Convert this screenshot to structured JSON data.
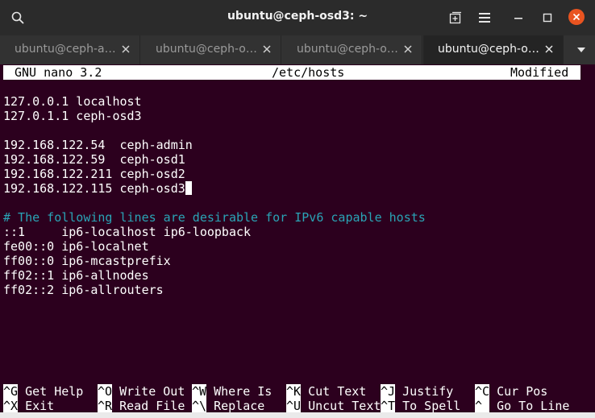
{
  "window": {
    "title": "ubuntu@ceph-osd3: ~",
    "close_color": "#e95420",
    "icons": [
      "search-icon",
      "new-tab-icon",
      "hamburger-menu-icon",
      "minimize-icon",
      "maximize-icon",
      "close-icon"
    ]
  },
  "tabs": [
    {
      "label": "ubuntu@ceph-a…",
      "active": false
    },
    {
      "label": "ubuntu@ceph-o…",
      "active": false
    },
    {
      "label": "ubuntu@ceph-o…",
      "active": false
    },
    {
      "label": "ubuntu@ceph-o…",
      "active": true
    }
  ],
  "nano": {
    "version": "GNU nano 3.2",
    "filename": "/etc/hosts",
    "status": "Modified"
  },
  "file_lines": [
    "",
    "127.0.0.1 localhost",
    "127.0.1.1 ceph-osd3",
    "",
    "192.168.122.54  ceph-admin",
    "192.168.122.59  ceph-osd1",
    "192.168.122.211 ceph-osd2",
    "192.168.122.115 ceph-osd3",
    "",
    "# The following lines are desirable for IPv6 capable hosts",
    "::1     ip6-localhost ip6-loopback",
    "fe00::0 ip6-localnet",
    "ff00::0 ip6-mcastprefix",
    "ff02::1 ip6-allnodes",
    "ff02::2 ip6-allrouters"
  ],
  "shortcuts": [
    [
      {
        "key": "^G",
        "label": "Get Help"
      },
      {
        "key": "^O",
        "label": "Write Out"
      },
      {
        "key": "^W",
        "label": "Where Is"
      },
      {
        "key": "^K",
        "label": "Cut Text"
      },
      {
        "key": "^J",
        "label": "Justify"
      },
      {
        "key": "^C",
        "label": "Cur Pos"
      }
    ],
    [
      {
        "key": "^X",
        "label": "Exit"
      },
      {
        "key": "^R",
        "label": "Read File"
      },
      {
        "key": "^\\",
        "label": "Replace"
      },
      {
        "key": "^U",
        "label": "Uncut Text"
      },
      {
        "key": "^T",
        "label": "To Spell"
      },
      {
        "key": "^_",
        "label": "Go To Line"
      }
    ]
  ],
  "colors": {
    "terminal_bg": "#2c001e",
    "comment": "#2aa4b6",
    "text": "#ffffff"
  }
}
